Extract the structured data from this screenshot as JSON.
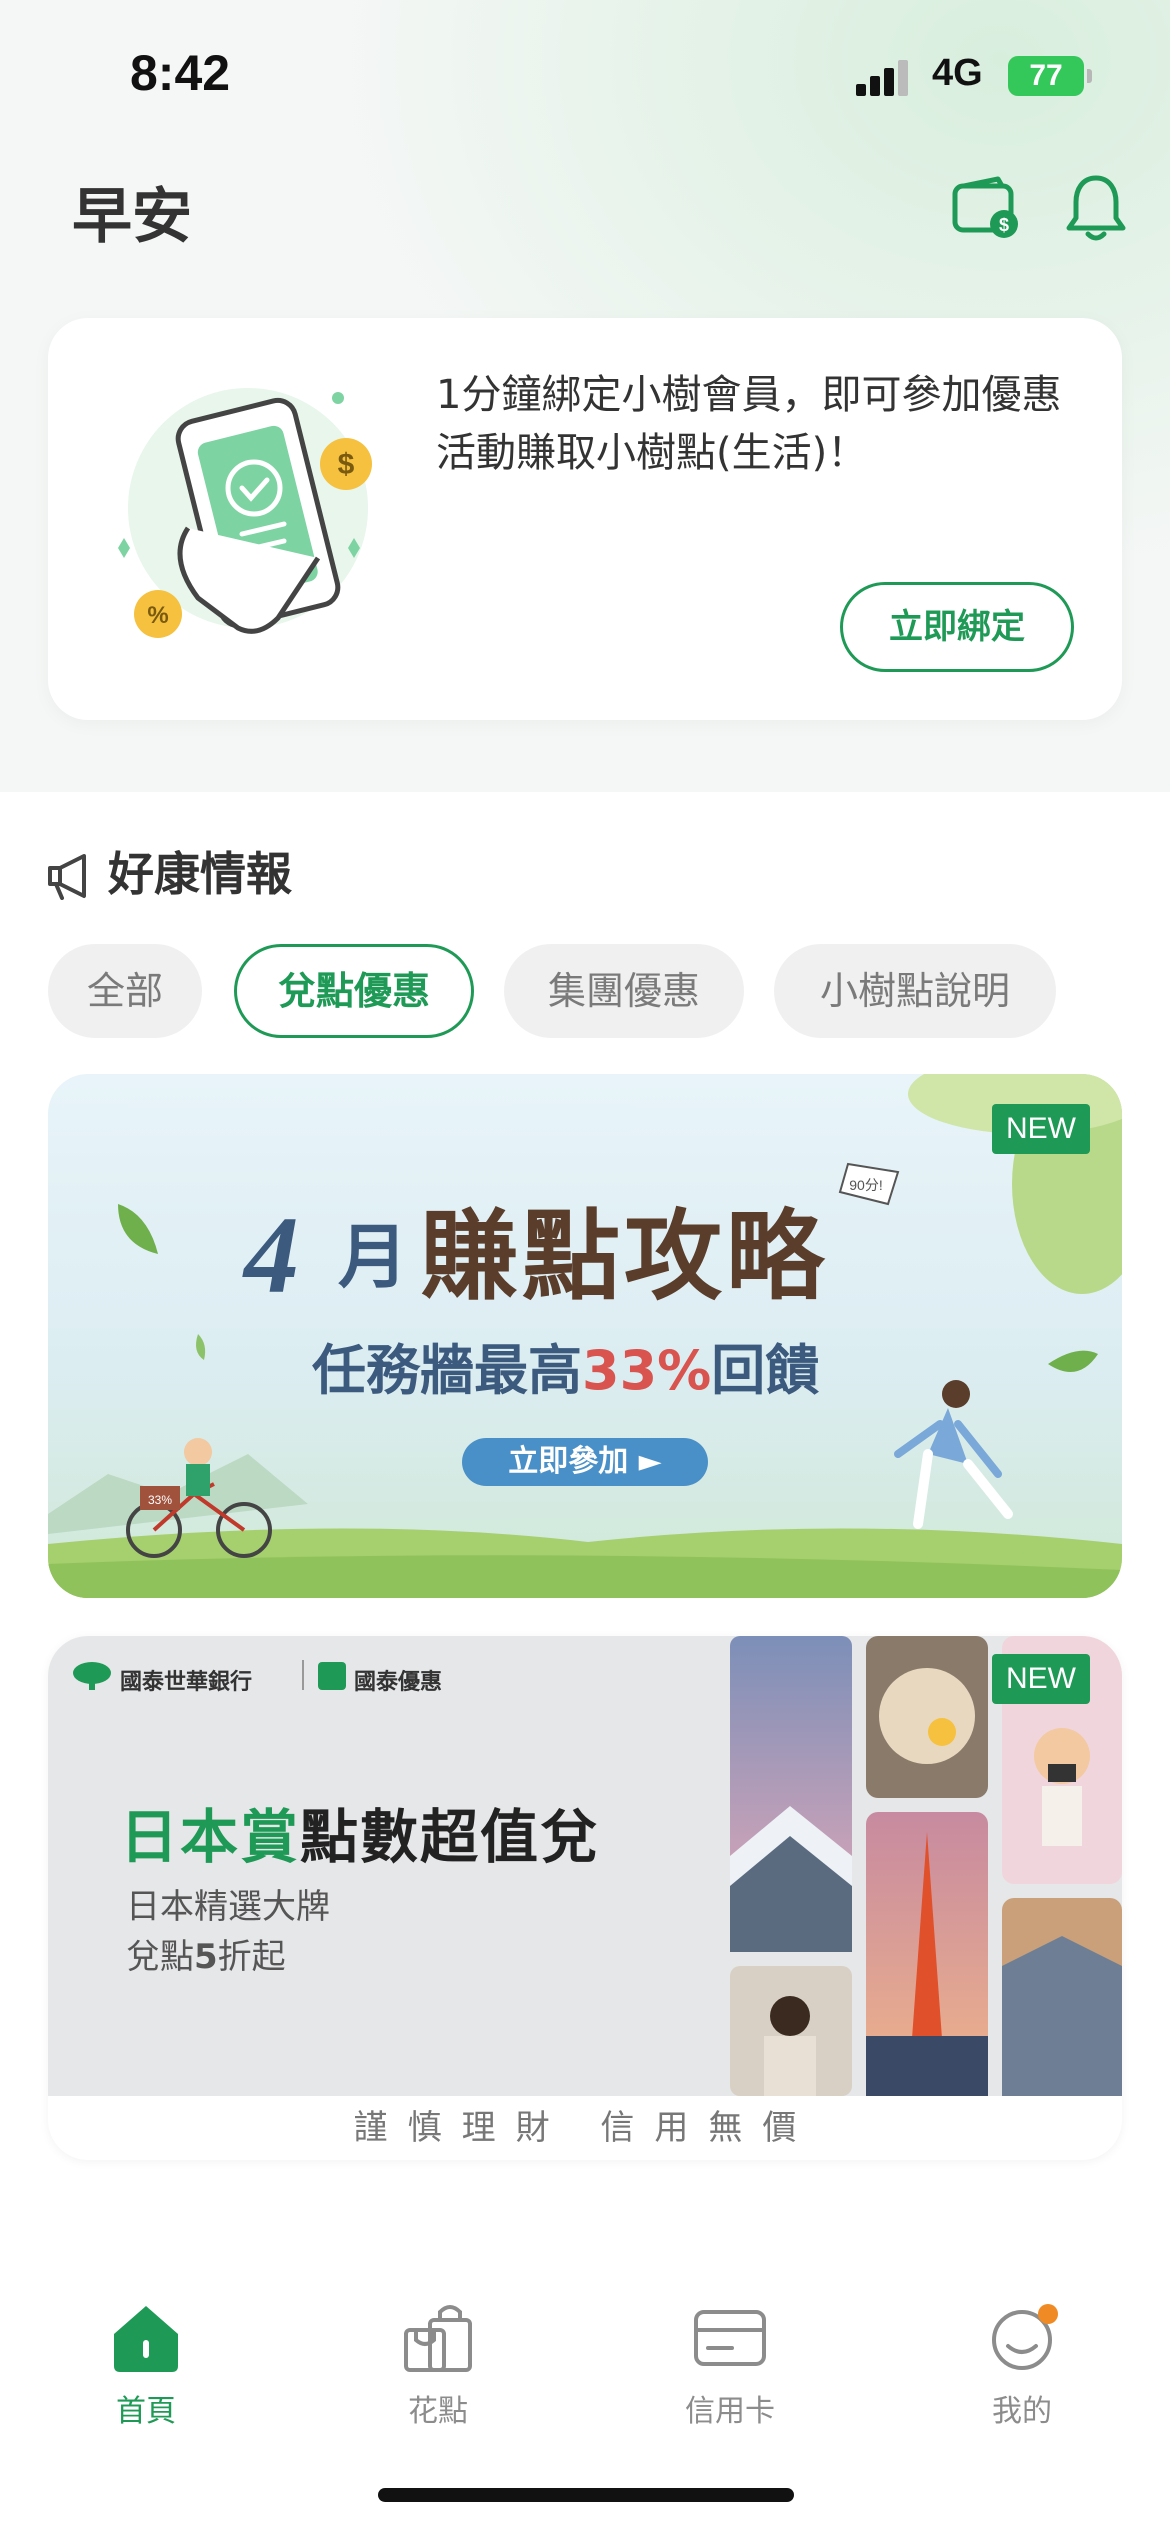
{
  "status_bar": {
    "time": "8:42",
    "network": "4G",
    "battery": "77"
  },
  "header": {
    "greeting": "早安",
    "icons": [
      "wallet-dollar-icon",
      "bell-icon"
    ]
  },
  "bind_card": {
    "text": "1分鐘綁定小樹會員，即可參加優惠活動賺取小樹點(生活)！",
    "button": "立即綁定"
  },
  "deals": {
    "title": "好康情報",
    "chips": [
      {
        "label": "全部",
        "active": false
      },
      {
        "label": "兌點優惠",
        "active": true
      },
      {
        "label": "集團優惠",
        "active": false
      },
      {
        "label": "小樹點說明",
        "active": false
      }
    ]
  },
  "banner1": {
    "badge": "NEW",
    "month_num": "4",
    "month_char": "月",
    "title": "賺點攻略",
    "sub_a": "任務牆最高",
    "sub_hl": "33%",
    "sub_b": "回饋",
    "cta": "立即參加 ►",
    "flag_text": "90分!",
    "sign_text": "33%"
  },
  "banner2": {
    "badge": "NEW",
    "bank": "國泰世華銀行",
    "promo": "國泰優惠",
    "title_green": "日本賞",
    "title_rest": "點數超值兌",
    "sub_line1": "日本精選大牌",
    "sub_line2_a": "兌點",
    "sub_line2_b": "5",
    "sub_line2_c": "折起",
    "footer": "謹慎理財 信用無價"
  },
  "tabbar": [
    {
      "label": "首頁",
      "icon": "home-icon",
      "active": true
    },
    {
      "label": "花點",
      "icon": "shopping-bag-icon",
      "active": false
    },
    {
      "label": "信用卡",
      "icon": "credit-card-icon",
      "active": false
    },
    {
      "label": "我的",
      "icon": "profile-icon",
      "active": false
    }
  ],
  "colors": {
    "brand": "#1f9a56",
    "accent_red": "#d9534f",
    "notice_dot": "#f08a24"
  }
}
